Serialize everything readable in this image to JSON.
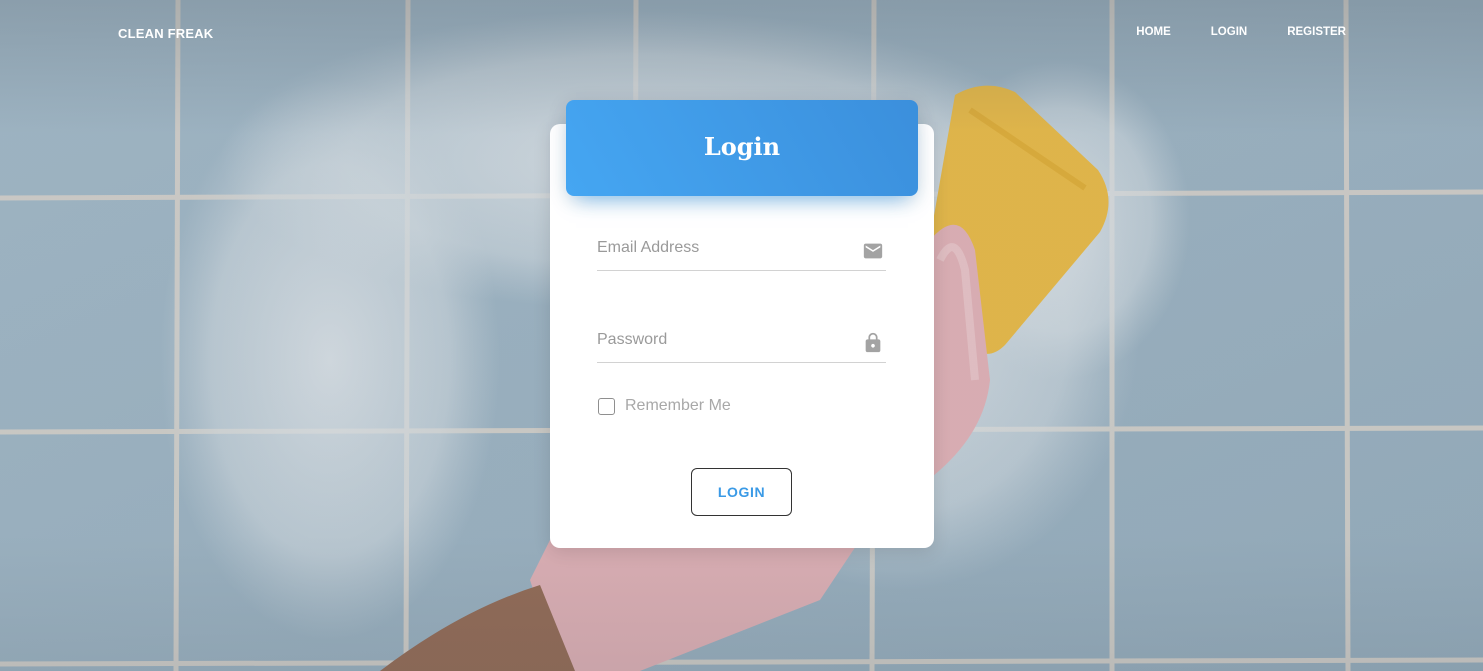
{
  "navbar": {
    "brand": "CLEAN FREAK",
    "links": [
      {
        "label": "HOME"
      },
      {
        "label": "LOGIN"
      },
      {
        "label": "REGISTER"
      }
    ]
  },
  "login_card": {
    "title": "Login",
    "email": {
      "placeholder": "Email Address",
      "value": "",
      "icon": "email-icon"
    },
    "password": {
      "placeholder": "Password",
      "value": "",
      "icon": "lock-icon"
    },
    "remember_label": "Remember Me",
    "remember_checked": false,
    "submit_label": "LOGIN"
  },
  "colors": {
    "header_gradient_start": "#45a6f2",
    "header_gradient_end": "#3b8fdc",
    "button_text": "#3a9ae6"
  }
}
